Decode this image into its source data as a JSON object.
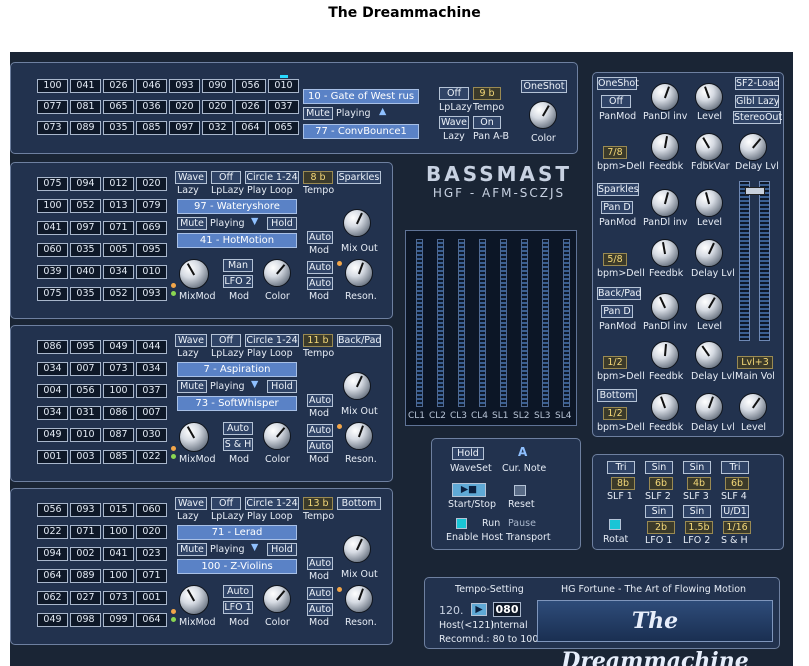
{
  "title": "The Dreammachine",
  "logo": {
    "line1": "BASSMAST",
    "line2": "HGF - AFM-SCZJS"
  },
  "meter_labels": [
    "CL1",
    "CL2",
    "CL3",
    "CL4",
    "SL1",
    "SL2",
    "SL3",
    "SL4"
  ],
  "panel0": {
    "grid": [
      [
        "100",
        "041",
        "026",
        "046",
        "093",
        "090",
        "056",
        "010"
      ],
      [
        "077",
        "081",
        "065",
        "036",
        "020",
        "020",
        "026",
        "037"
      ],
      [
        "073",
        "089",
        "035",
        "085",
        "097",
        "032",
        "064",
        "065"
      ]
    ],
    "wave1": "10 - Gate of West rus",
    "mute": "Mute",
    "playing": "Playing",
    "wave2": "77 - ConvBounce1",
    "off": "Off",
    "tempo_val": "9 b",
    "lplazy": "LpLazy",
    "tempo": "Tempo",
    "wave": "Wave",
    "on": "On",
    "lazy": "Lazy",
    "panab": "Pan A-B",
    "oneshot": "OneShot",
    "color": "Color"
  },
  "panel1": {
    "grid": [
      [
        "075",
        "094",
        "012",
        "020"
      ],
      [
        "100",
        "052",
        "013",
        "079"
      ],
      [
        "041",
        "097",
        "071",
        "069"
      ],
      [
        "060",
        "035",
        "005",
        "095"
      ],
      [
        "039",
        "040",
        "034",
        "010"
      ],
      [
        "075",
        "035",
        "052",
        "093"
      ]
    ],
    "wave": "Wave",
    "off": "Off",
    "circle": "Circle 1-24",
    "tempo_val": "8 b",
    "preset": "Sparkles",
    "lazy": "Lazy",
    "lplazy": "LpLazy",
    "playloop": "Play Loop",
    "tempo": "Tempo",
    "sel1": "97 - Wateryshore",
    "mute": "Mute",
    "playing": "Playing",
    "hold": "Hold",
    "sel2": "41 - HotMotion",
    "auto": "Auto",
    "mod": "Mod",
    "mixout": "Mix Out",
    "mod_type": "Man",
    "lfo": "LFO 2",
    "mixmod": "MixMod",
    "color": "Color",
    "reson": "Reson."
  },
  "panel2": {
    "grid": [
      [
        "086",
        "095",
        "049",
        "044"
      ],
      [
        "034",
        "007",
        "073",
        "034"
      ],
      [
        "004",
        "056",
        "100",
        "037"
      ],
      [
        "034",
        "031",
        "086",
        "007"
      ],
      [
        "049",
        "010",
        "087",
        "030"
      ],
      [
        "001",
        "003",
        "085",
        "022"
      ]
    ],
    "wave": "Wave",
    "off": "Off",
    "circle": "Circle 1-24",
    "tempo_val": "11 b",
    "preset": "Back/Pad",
    "lazy": "Lazy",
    "lplazy": "LpLazy",
    "playloop": "Play Loop",
    "tempo": "Tempo",
    "sel1": "7 - Aspiration",
    "mute": "Mute",
    "playing": "Playing",
    "hold": "Hold",
    "sel2": "73 - SoftWhisper",
    "auto": "Auto",
    "mod": "Mod",
    "mixout": "Mix Out",
    "mod_type": "Auto",
    "lfo": "S & H",
    "mixmod": "MixMod",
    "color": "Color",
    "reson": "Reson."
  },
  "panel3": {
    "grid": [
      [
        "056",
        "093",
        "015",
        "060"
      ],
      [
        "022",
        "071",
        "100",
        "020"
      ],
      [
        "094",
        "002",
        "041",
        "023"
      ],
      [
        "064",
        "089",
        "100",
        "071"
      ],
      [
        "062",
        "027",
        "073",
        "001"
      ],
      [
        "049",
        "098",
        "099",
        "064"
      ]
    ],
    "wave": "Wave",
    "off": "Off",
    "circle": "Circle 1-24",
    "tempo_val": "13 b",
    "preset": "Bottom",
    "lazy": "Lazy",
    "lplazy": "LpLazy",
    "playloop": "Play Loop",
    "tempo": "Tempo",
    "sel1": "71 - Lerad",
    "mute": "Mute",
    "playing": "Playing",
    "hold": "Hold",
    "sel2": "100 - Z-Violins",
    "auto": "Auto",
    "mod": "Mod",
    "mixout": "Mix Out",
    "mod_type": "Auto",
    "lfo": "LFO 1",
    "mixmod": "MixMod",
    "color": "Color",
    "reson": "Reson."
  },
  "right": {
    "oneshot": "OneShot",
    "off": "Off",
    "panmod": "PanMod",
    "pandlinv": "PanDl inv",
    "level": "Level",
    "sf2load": "SF2-Load",
    "glbllazy": "Glbl Lazy",
    "stereoout": "StereoOut",
    "bpm1": "7/8",
    "bpmdell": "bpm>Dell",
    "feedbk": "Feedbk",
    "fdbkvar": "FdbkVar",
    "delaylvl": "Delay Lvl",
    "sparkles": "Sparkles",
    "pand": "Pan D",
    "bpm2": "5/8",
    "backpad": "Back/Pad",
    "bpm3": "1/2",
    "lvl": "Lvl+3",
    "mainvol": "Main Vol",
    "bottom": "Bottom",
    "bpm4": "1/2"
  },
  "transport": {
    "hold": "Hold",
    "note": "A",
    "waveset": "WaveSet",
    "curnote": "Cur. Note",
    "startstop": "Start/Stop",
    "reset": "Reset",
    "run": "Run",
    "pause": "Pause",
    "host": "Enable Host Transport"
  },
  "lfo": {
    "top": [
      "Tri",
      "Sin",
      "Sin",
      "Tri"
    ],
    "top_vals": [
      "8b",
      "6b",
      "4b",
      "6b"
    ],
    "slf": [
      "SLF 1",
      "SLF 2",
      "SLF 3",
      "SLF 4"
    ],
    "bot": [
      "Sin",
      "Sin",
      "U/D1"
    ],
    "bot_vals": [
      "2b",
      "1.5b",
      "1/16"
    ],
    "bot_labels": [
      "LFO 1",
      "LFO 2",
      "S & H"
    ],
    "rotat": "Rotat"
  },
  "tempo": {
    "title": "Tempo-Setting",
    "value": "120.",
    "int_val": "080",
    "host": "Host(<121)",
    "internal": "Internal",
    "recommend": "Recomnd.: 80 to 100",
    "credit": "HG Fortune - The Art of Flowing Motion",
    "brand": "The Dreammachine"
  }
}
